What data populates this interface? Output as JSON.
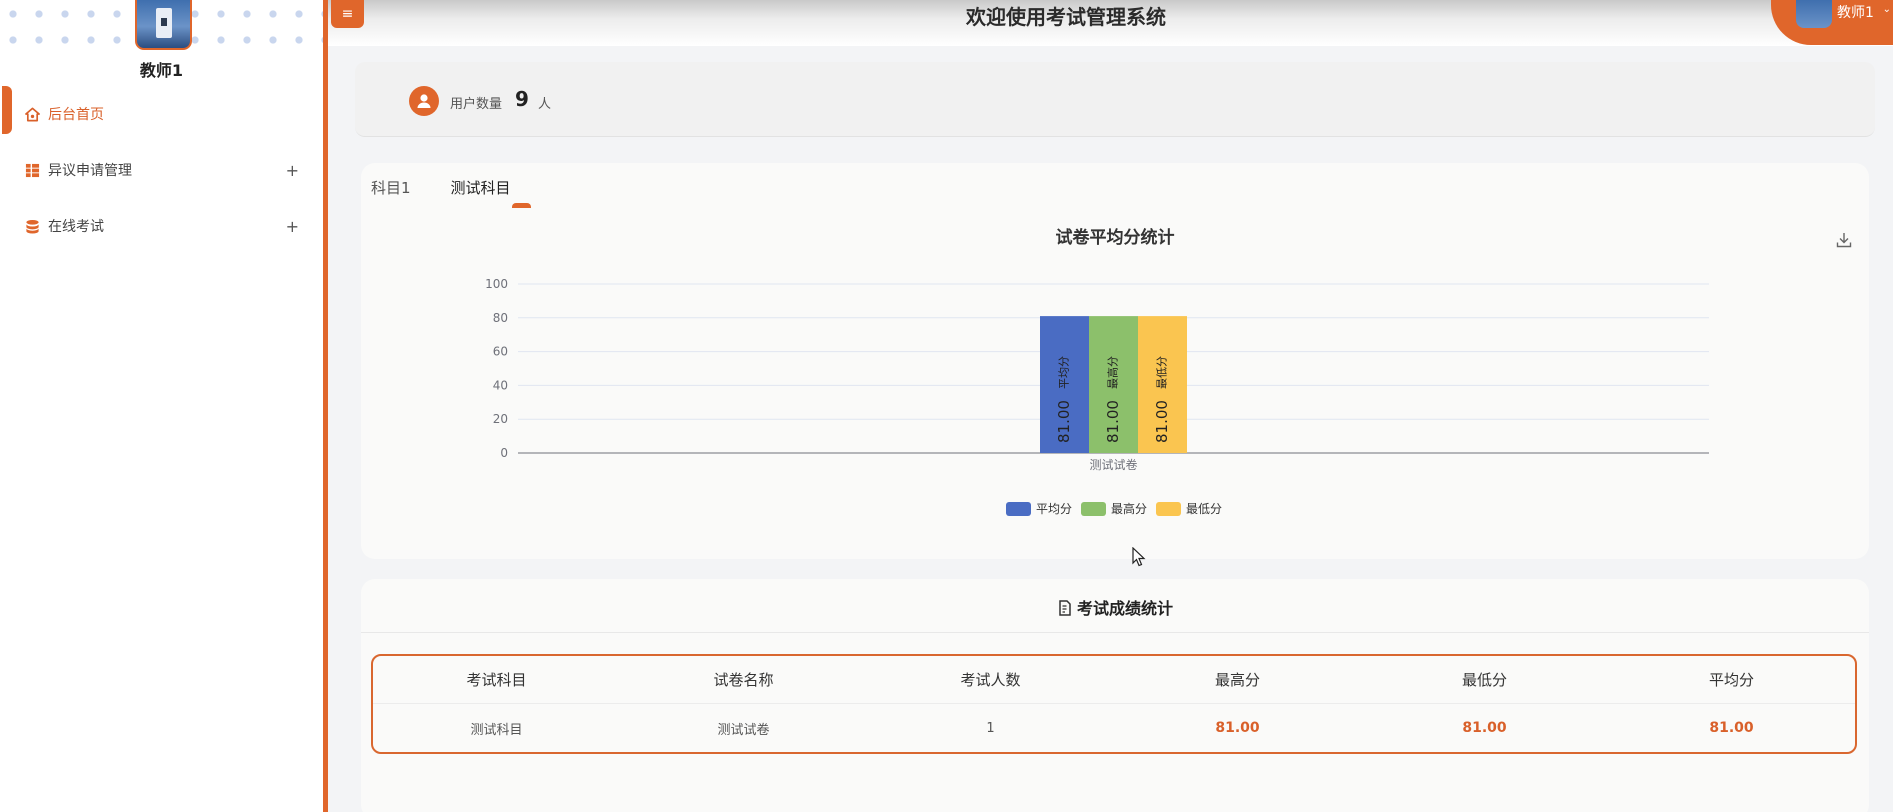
{
  "sidebar": {
    "username": "教师1",
    "items": [
      {
        "label": "后台首页",
        "icon": "home-icon",
        "active": true
      },
      {
        "label": "异议申请管理",
        "icon": "grid-icon",
        "expand": "+"
      },
      {
        "label": "在线考试",
        "icon": "database-icon",
        "expand": "+"
      }
    ]
  },
  "header": {
    "menu_toggle": "≡",
    "title": "欢迎使用考试管理系统",
    "user_name": "教师1",
    "caret": "⌄"
  },
  "stats": {
    "label": "用户数量",
    "value": "9",
    "unit": "人"
  },
  "chart_panel": {
    "tabs": [
      "科目1",
      "测试科目"
    ],
    "active_tab": 1
  },
  "chart_data": {
    "type": "bar",
    "title": "试卷平均分统计",
    "categories": [
      "测试试卷"
    ],
    "ylim": [
      0,
      100
    ],
    "yticks": [
      0,
      20,
      40,
      60,
      80,
      100
    ],
    "grid": true,
    "legend_position": "bottom-center",
    "series": [
      {
        "name": "平均分",
        "values": [
          81.0
        ],
        "labels": [
          "81.00"
        ],
        "color": "#4a6cc3"
      },
      {
        "name": "最高分",
        "values": [
          81.0
        ],
        "labels": [
          "81.00"
        ],
        "color": "#8cc06b"
      },
      {
        "name": "最低分",
        "values": [
          81.0
        ],
        "labels": [
          "81.00"
        ],
        "color": "#fac550"
      }
    ]
  },
  "score_table": {
    "title": "考试成绩统计",
    "columns": [
      "考试科目",
      "试卷名称",
      "考试人数",
      "最高分",
      "最低分",
      "平均分"
    ],
    "rows": [
      [
        "测试科目",
        "测试试卷",
        "1",
        "81.00",
        "81.00",
        "81.00"
      ]
    ]
  },
  "colors": {
    "accent": "#e0662b",
    "background": "#f3f4f6"
  }
}
